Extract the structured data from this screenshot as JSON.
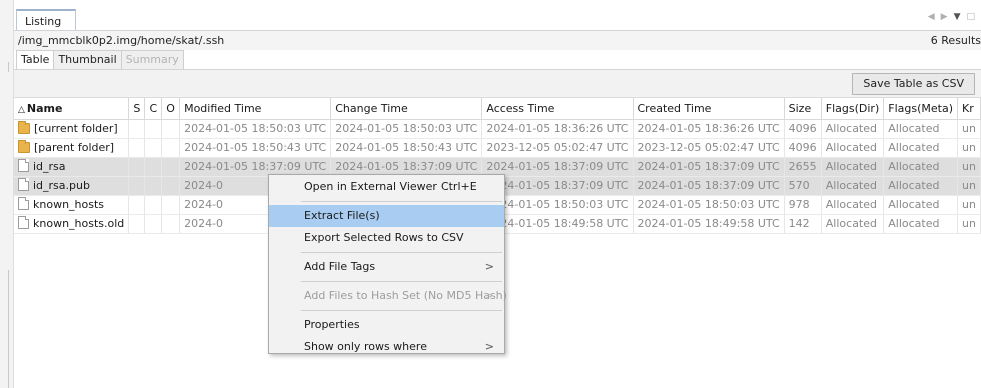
{
  "window": {
    "tab_label": "Listing",
    "path": "/img_mmcblk0p2.img/home/skat/.ssh",
    "results": "6  Results"
  },
  "subtabs": [
    {
      "label": "Table",
      "state": "active"
    },
    {
      "label": "Thumbnail",
      "state": "normal"
    },
    {
      "label": "Summary",
      "state": "disabled"
    }
  ],
  "toolbar": {
    "save_label": "Save Table as CSV"
  },
  "table": {
    "headers": {
      "name": "Name",
      "s": "S",
      "c": "C",
      "o": "O",
      "modified": "Modified Time",
      "change": "Change Time",
      "access": "Access Time",
      "created": "Created Time",
      "size": "Size",
      "flags_dir": "Flags(Dir)",
      "flags_meta": "Flags(Meta)",
      "known": "Kr"
    },
    "rows": [
      {
        "icon": "folder-icon",
        "name": "[current folder]",
        "modified": "2024-01-05 18:50:03 UTC",
        "change": "2024-01-05 18:50:03 UTC",
        "access": "2024-01-05 18:36:26 UTC",
        "created": "2024-01-05 18:36:26 UTC",
        "size": "4096",
        "flags_dir": "Allocated",
        "flags_meta": "Allocated",
        "known": "un"
      },
      {
        "icon": "folder-icon",
        "name": "[parent folder]",
        "modified": "2024-01-05 18:50:43 UTC",
        "change": "2024-01-05 18:50:43 UTC",
        "access": "2023-12-05 05:02:47 UTC",
        "created": "2023-12-05 05:02:47 UTC",
        "size": "4096",
        "flags_dir": "Allocated",
        "flags_meta": "Allocated",
        "known": "un"
      },
      {
        "icon": "file-icon",
        "name": "id_rsa",
        "modified": "2024-01-05 18:37:09 UTC",
        "change": "2024-01-05 18:37:09 UTC",
        "access": "2024-01-05 18:37:09 UTC",
        "created": "2024-01-05 18:37:09 UTC",
        "size": "2655",
        "flags_dir": "Allocated",
        "flags_meta": "Allocated",
        "known": "un"
      },
      {
        "icon": "file-icon",
        "name": "id_rsa.pub",
        "modified": "2024-0",
        "change": "",
        "access": "2024-01-05 18:37:09 UTC",
        "created": "2024-01-05 18:37:09 UTC",
        "size": "570",
        "flags_dir": "Allocated",
        "flags_meta": "Allocated",
        "known": "un"
      },
      {
        "icon": "file-icon",
        "name": "known_hosts",
        "modified": "2024-0",
        "change": "",
        "access": "2024-01-05 18:50:03 UTC",
        "created": "2024-01-05 18:50:03 UTC",
        "size": "978",
        "flags_dir": "Allocated",
        "flags_meta": "Allocated",
        "known": "un"
      },
      {
        "icon": "file-icon",
        "name": "known_hosts.old",
        "modified": "2024-0",
        "change": "",
        "access": "2024-01-05 18:49:58 UTC",
        "created": "2024-01-05 18:49:58 UTC",
        "size": "142",
        "flags_dir": "Allocated",
        "flags_meta": "Allocated",
        "known": "un"
      }
    ]
  },
  "context_menu": {
    "open_external": "Open in External Viewer",
    "open_external_shortcut": "Ctrl+E",
    "extract": "Extract File(s)",
    "export_csv": "Export Selected Rows to CSV",
    "add_tags": "Add File Tags",
    "add_hash": "Add Files to Hash Set (No MD5 Hash)",
    "properties": "Properties",
    "show_only": "Show only rows where",
    "submenu_glyph": ">"
  },
  "colors": {
    "highlight": "#a9cdf2",
    "selected_row": "#dedede",
    "folder": "#e9b44c"
  }
}
